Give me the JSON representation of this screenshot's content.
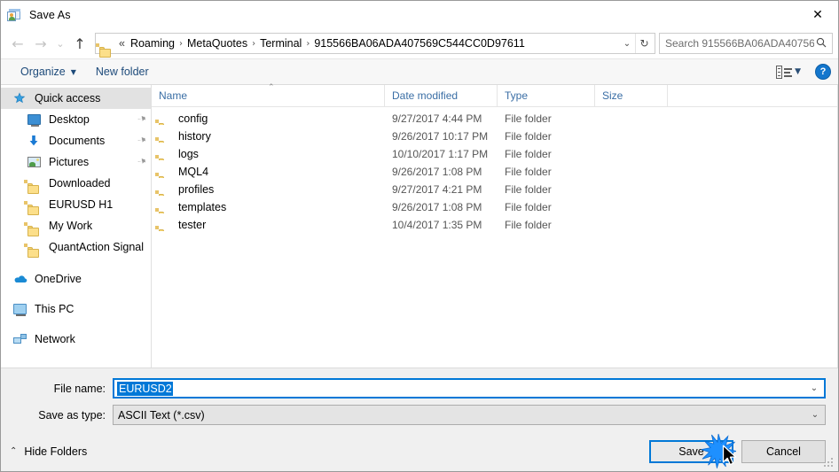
{
  "window": {
    "title": "Save As",
    "title_icon": "save-as-window-icon",
    "close_label": "✕"
  },
  "nav": {
    "back_icon": "←",
    "forward_icon": "→",
    "recent_icon": "⌄",
    "up_icon": "↑",
    "refresh_icon": "↻",
    "chevron_icon": "⌄",
    "breadcrumb_lead": "«",
    "breadcrumb": [
      "Roaming",
      "MetaQuotes",
      "Terminal",
      "915566BA06ADA407569C544CC0D97611"
    ],
    "separator": "›"
  },
  "search": {
    "placeholder": "Search 915566BA06ADA40756...",
    "icon": "⚲"
  },
  "toolbar": {
    "organize_label": "Organize",
    "organize_caret": "▼",
    "new_folder_label": "New folder",
    "view_caret": "▼",
    "help_label": "?"
  },
  "sidebar": {
    "items": [
      {
        "label": "Quick access",
        "icon": "star-icon",
        "selected": true,
        "pinned": false,
        "indent": "0"
      },
      {
        "label": "Desktop",
        "icon": "monitor-icon",
        "selected": false,
        "pinned": true,
        "indent": "1"
      },
      {
        "label": "Documents",
        "icon": "download-arrow-icon",
        "selected": false,
        "pinned": true,
        "indent": "1"
      },
      {
        "label": "Pictures",
        "icon": "picture-icon",
        "selected": false,
        "pinned": true,
        "indent": "1"
      },
      {
        "label": "Downloaded",
        "icon": "folder-icon",
        "selected": false,
        "pinned": false,
        "indent": "1"
      },
      {
        "label": "EURUSD H1",
        "icon": "folder-icon",
        "selected": false,
        "pinned": false,
        "indent": "1"
      },
      {
        "label": "My Work",
        "icon": "folder-icon",
        "selected": false,
        "pinned": false,
        "indent": "1"
      },
      {
        "label": "QuantAction Signal",
        "icon": "folder-icon",
        "selected": false,
        "pinned": false,
        "indent": "1"
      },
      {
        "label": "OneDrive",
        "icon": "cloud-icon",
        "selected": false,
        "pinned": false,
        "indent": "0",
        "gap": true
      },
      {
        "label": "This PC",
        "icon": "pc-icon",
        "selected": false,
        "pinned": false,
        "indent": "0",
        "gap": true
      },
      {
        "label": "Network",
        "icon": "network-icon",
        "selected": false,
        "pinned": false,
        "indent": "0",
        "gap": true
      }
    ],
    "pin_icon": "📌"
  },
  "filelist": {
    "columns": [
      "Name",
      "Date modified",
      "Type",
      "Size"
    ],
    "sort_caret": "⌃",
    "rows": [
      {
        "name": "config",
        "date": "9/27/2017 4:44 PM",
        "type": "File folder",
        "size": ""
      },
      {
        "name": "history",
        "date": "9/26/2017 10:17 PM",
        "type": "File folder",
        "size": ""
      },
      {
        "name": "logs",
        "date": "10/10/2017 1:17 PM",
        "type": "File folder",
        "size": ""
      },
      {
        "name": "MQL4",
        "date": "9/26/2017 1:08 PM",
        "type": "File folder",
        "size": ""
      },
      {
        "name": "profiles",
        "date": "9/27/2017 4:21 PM",
        "type": "File folder",
        "size": ""
      },
      {
        "name": "templates",
        "date": "9/26/2017 1:08 PM",
        "type": "File folder",
        "size": ""
      },
      {
        "name": "tester",
        "date": "10/4/2017 1:35 PM",
        "type": "File folder",
        "size": ""
      }
    ]
  },
  "form": {
    "filename_label": "File name:",
    "filename_value": "EURUSD2",
    "filetype_label": "Save as type:",
    "filetype_value": "ASCII Text (*.csv)",
    "dropdown_arrow": "⌄"
  },
  "footer": {
    "hide_folders_label": "Hide Folders",
    "hide_folders_caret": "⌃",
    "save_label": "Save",
    "cancel_label": "Cancel"
  },
  "colors": {
    "accent": "#0078d7",
    "link": "#1d4a7a",
    "column_header": "#3a6ea5",
    "folder": "#fcdf8a",
    "selection": "#0078d7",
    "help_blue": "#1376cd"
  }
}
